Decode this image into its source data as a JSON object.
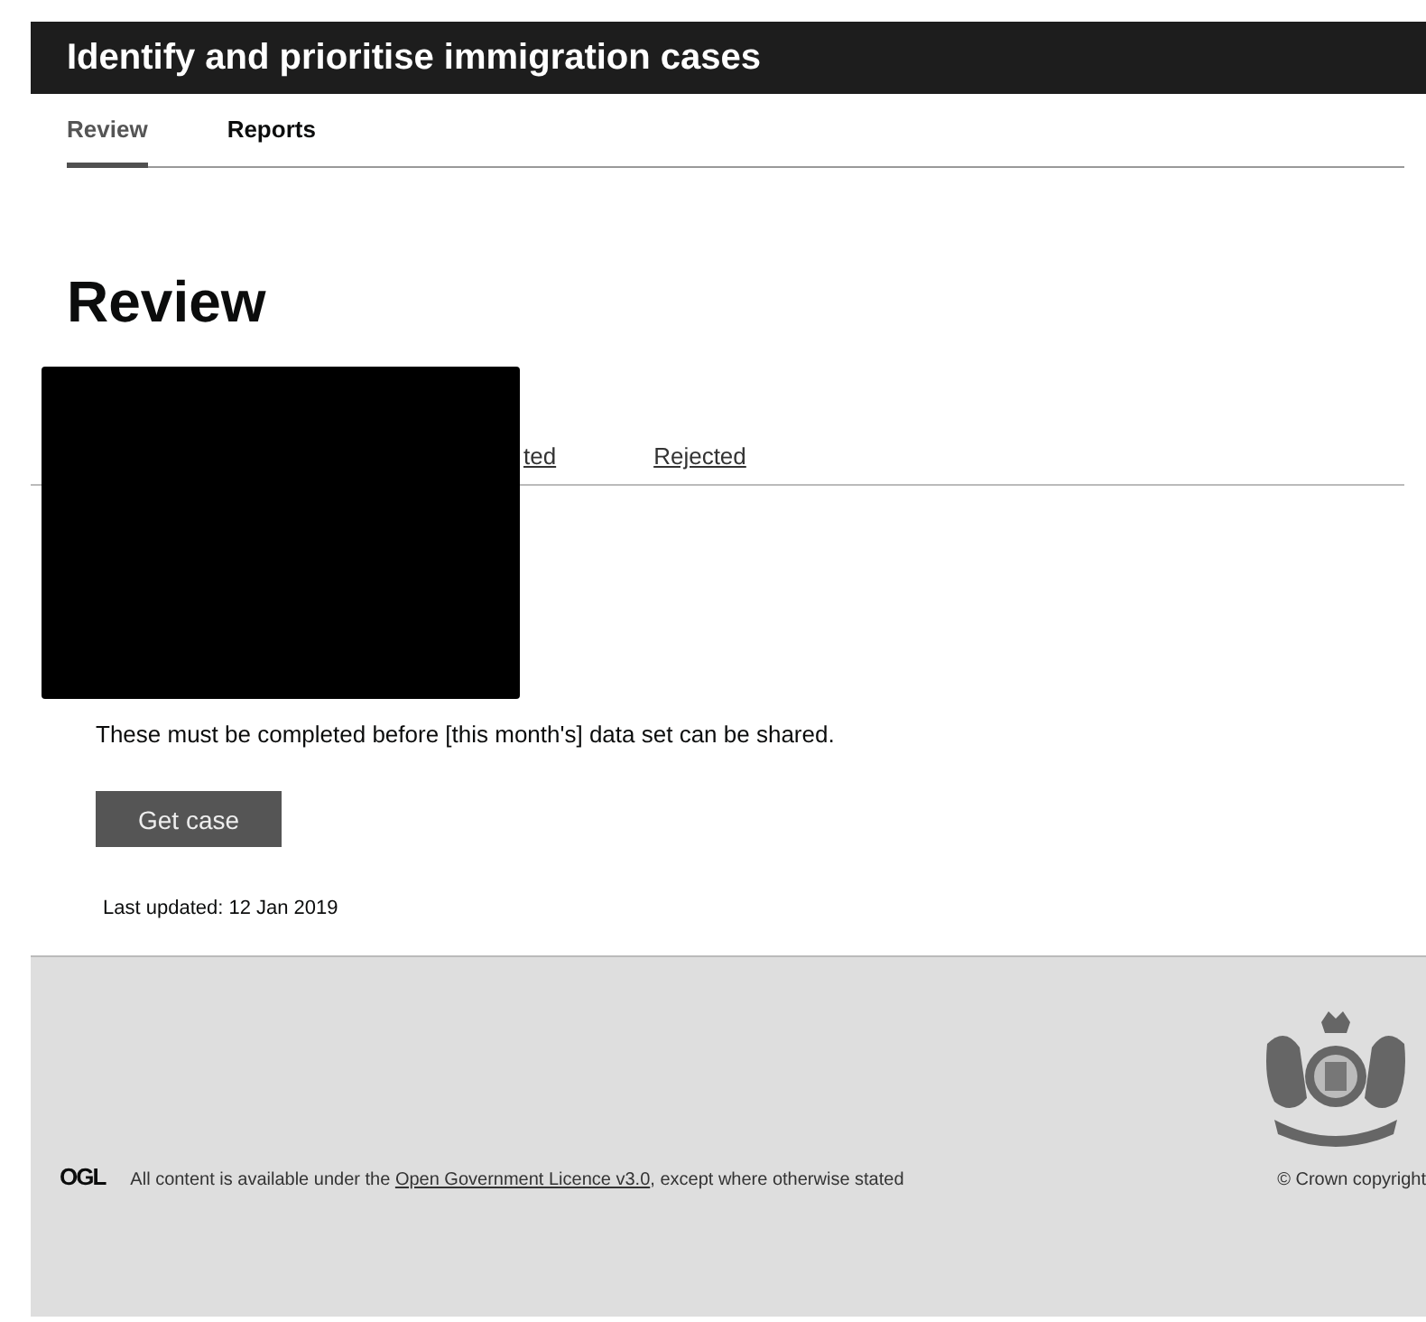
{
  "header": {
    "title": "Identify and prioritise immigration cases"
  },
  "nav": [
    {
      "label": "Review",
      "selected": true
    },
    {
      "label": "Reports",
      "selected": false
    }
  ],
  "page": {
    "heading": "Review"
  },
  "subtabs": [
    {
      "label": "ted"
    },
    {
      "label": "Rejected"
    }
  ],
  "redacted": true,
  "notice": "These must be completed before [this month's] data set can be shared.",
  "button": "Get case",
  "last_updated": "Last updated: 12 Jan 2019",
  "footer": {
    "logo": "OGL",
    "licence_before": "All content is available under the ",
    "licence_link": "Open Government Licence v3.0",
    "licence_after": ", except where otherwise stated",
    "copyright": "© Crown copyright"
  }
}
